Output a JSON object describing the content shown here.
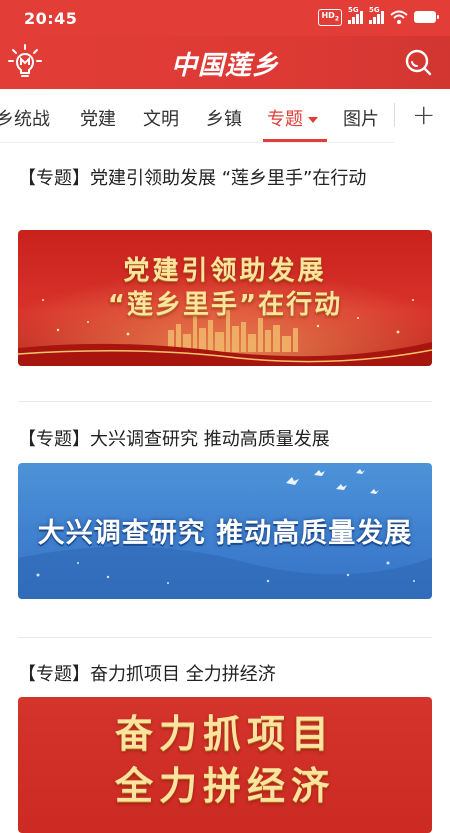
{
  "status_bar": {
    "time": "20:45",
    "signal1_label": "5G",
    "signal2_label": "5G",
    "hd_label": "HD",
    "hd_sub": "2"
  },
  "header": {
    "title": "中国莲乡",
    "left_icon": "lightbulb-icon",
    "right_icon": "search-icon"
  },
  "tabs": {
    "items": [
      {
        "label": "乡统战"
      },
      {
        "label": "党建"
      },
      {
        "label": "文明"
      },
      {
        "label": "乡镇"
      },
      {
        "label": "专题"
      },
      {
        "label": "图片"
      }
    ],
    "active_index": 4,
    "add_label": "+"
  },
  "articles": [
    {
      "title": "【专题】党建引领助发展 “莲乡里手”在行动",
      "banner_line1": "党建引领助发展",
      "banner_line2": "“莲乡里手”在行动"
    },
    {
      "title": "【专题】大兴调查研究 推动高质量发展",
      "banner_line1": "大兴调查研究  推动高质量发展"
    },
    {
      "title": "【专题】奋力抓项目 全力拼经济",
      "banner_line1": "奋力抓项目",
      "banner_line2": "全力拼经济"
    }
  ],
  "colors": {
    "brand_red": "#e23d37",
    "blue_banner": "#3f80cf",
    "gold_text": "#fde3a0"
  }
}
